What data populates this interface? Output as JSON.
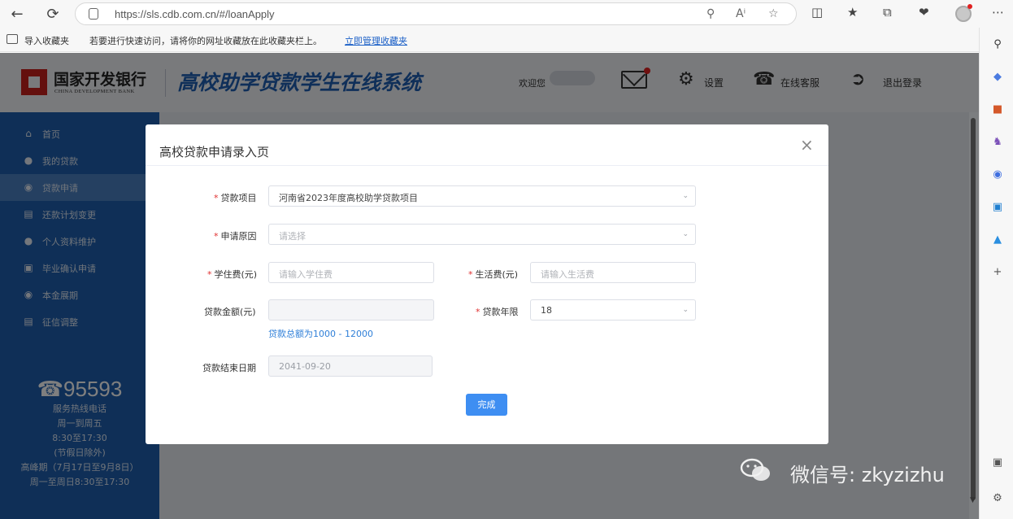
{
  "browser": {
    "url": "https://sls.cdb.com.cn/#/loanApply",
    "favorites_import": "导入收藏夹",
    "favorites_hint": "若要进行快速访问，请将你的网址收藏放在此收藏夹栏上。",
    "favorites_manage": "立即管理收藏夹"
  },
  "header": {
    "bank_name": "国家开发银行",
    "bank_name_en": "CHINA DEVELOPMENT BANK",
    "system_title": "高校助学贷款学生在线系统",
    "welcome": "欢迎您",
    "settings": "设置",
    "support": "在线客服",
    "logout": "退出登录"
  },
  "sidebar": {
    "items": [
      {
        "label": "首页",
        "icon": "home-icon"
      },
      {
        "label": "我的贷款",
        "icon": "user-loan-icon"
      },
      {
        "label": "贷款申请",
        "icon": "apply-icon"
      },
      {
        "label": "还款计划变更",
        "icon": "plan-icon"
      },
      {
        "label": "个人资料维护",
        "icon": "person-icon"
      },
      {
        "label": "毕业确认申请",
        "icon": "graduation-icon"
      },
      {
        "label": "本金展期",
        "icon": "extension-icon"
      },
      {
        "label": "征信调整",
        "icon": "credit-icon"
      }
    ],
    "active_index": 2
  },
  "hotline": {
    "number": "95593",
    "line1": "服务热线电话",
    "line2": "周一到周五",
    "line3": "8:30至17:30",
    "line4": "(节假日除外)",
    "line5": "高峰期（7月17日至9月8日）",
    "line6": "周一至周日8:30至17:30"
  },
  "modal": {
    "title": "高校贷款申请录入页",
    "required_mark": "*",
    "loan_project": {
      "label": "贷款项目",
      "value": "河南省2023年度高校助学贷款项目"
    },
    "reason": {
      "label": "申请原因",
      "placeholder": "请选择"
    },
    "tuition": {
      "label": "学住费(元)",
      "placeholder": "请输入学住费"
    },
    "living": {
      "label": "生活费(元)",
      "placeholder": "请输入生活费"
    },
    "amount": {
      "label": "贷款金额(元)",
      "value": "",
      "hint": "贷款总额为1000 - 12000"
    },
    "term": {
      "label": "贷款年限",
      "value": "18"
    },
    "end_date": {
      "label": "贷款结束日期",
      "value": "2041-09-20"
    },
    "submit": "完成"
  },
  "watermark": "微信号: zkyzizhu",
  "colors": {
    "brand_blue": "#1f5fae",
    "accent": "#3e8ef2",
    "required": "#e03030",
    "logo_red": "#c8201c"
  }
}
